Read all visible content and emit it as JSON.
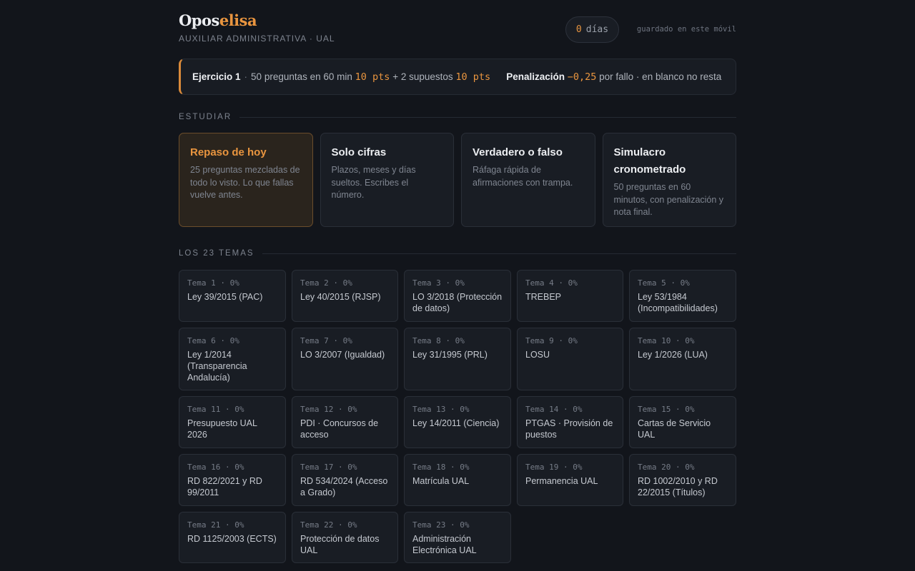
{
  "header": {
    "brand_main": "Opos",
    "brand_accent": "elisa",
    "subtitle": "AUXILIAR ADMINISTRATIVA · UAL",
    "days_value": "0",
    "days_label": "días",
    "saved_note": "guardado en este móvil"
  },
  "exercise": {
    "title": "Ejercicio 1",
    "questions_text": "50 preguntas en 60 min",
    "questions_points": "10 pts",
    "cases_text": "+ 2 supuestos",
    "cases_points": "10 pts",
    "penalty_label": "Penalización",
    "penalty_value": "−0,25",
    "penalty_text": "por fallo · en blanco no resta"
  },
  "study": {
    "heading": "ESTUDIAR",
    "cards": [
      {
        "title": "Repaso de hoy",
        "desc": "25 preguntas mezcladas de todo lo visto. Lo que fallas vuelve antes."
      },
      {
        "title": "Solo cifras",
        "desc": "Plazos, meses y días sueltos. Escribes el número."
      },
      {
        "title": "Verdadero o falso",
        "desc": "Ráfaga rápida de afirmaciones con trampa."
      },
      {
        "title": "Simulacro cronometrado",
        "desc": "50 preguntas en 60 minutos, con penalización y nota final."
      }
    ]
  },
  "topics": {
    "heading": "LOS 23 TEMAS",
    "items": [
      {
        "num": "Tema 1 · 0%",
        "name": "Ley 39/2015 (PAC)"
      },
      {
        "num": "Tema 2 · 0%",
        "name": "Ley 40/2015 (RJSP)"
      },
      {
        "num": "Tema 3 · 0%",
        "name": "LO 3/2018 (Protección de datos)"
      },
      {
        "num": "Tema 4 · 0%",
        "name": "TREBEP"
      },
      {
        "num": "Tema 5 · 0%",
        "name": "Ley 53/1984 (Incompatibilidades)"
      },
      {
        "num": "Tema 6 · 0%",
        "name": "Ley 1/2014 (Transparencia Andalucía)"
      },
      {
        "num": "Tema 7 · 0%",
        "name": "LO 3/2007 (Igualdad)"
      },
      {
        "num": "Tema 8 · 0%",
        "name": "Ley 31/1995 (PRL)"
      },
      {
        "num": "Tema 9 · 0%",
        "name": "LOSU"
      },
      {
        "num": "Tema 10 · 0%",
        "name": "Ley 1/2026 (LUA)"
      },
      {
        "num": "Tema 11 · 0%",
        "name": "Presupuesto UAL 2026"
      },
      {
        "num": "Tema 12 · 0%",
        "name": "PDI · Concursos de acceso"
      },
      {
        "num": "Tema 13 · 0%",
        "name": "Ley 14/2011 (Ciencia)"
      },
      {
        "num": "Tema 14 · 0%",
        "name": "PTGAS · Provisión de puestos"
      },
      {
        "num": "Tema 15 · 0%",
        "name": "Cartas de Servicio UAL"
      },
      {
        "num": "Tema 16 · 0%",
        "name": "RD 822/2021 y RD 99/2011"
      },
      {
        "num": "Tema 17 · 0%",
        "name": "RD 534/2024 (Acceso a Grado)"
      },
      {
        "num": "Tema 18 · 0%",
        "name": "Matrícula UAL"
      },
      {
        "num": "Tema 19 · 0%",
        "name": "Permanencia UAL"
      },
      {
        "num": "Tema 20 · 0%",
        "name": "RD 1002/2010 y RD 22/2015 (Títulos)"
      },
      {
        "num": "Tema 21 · 0%",
        "name": "RD 1125/2003 (ECTS)"
      },
      {
        "num": "Tema 22 · 0%",
        "name": "Protección de datos UAL"
      },
      {
        "num": "Tema 23 · 0%",
        "name": "Administración Electrónica UAL"
      }
    ]
  },
  "colors": {
    "accent": "#e9953f",
    "background": "#12151b",
    "card": "#191d24"
  }
}
